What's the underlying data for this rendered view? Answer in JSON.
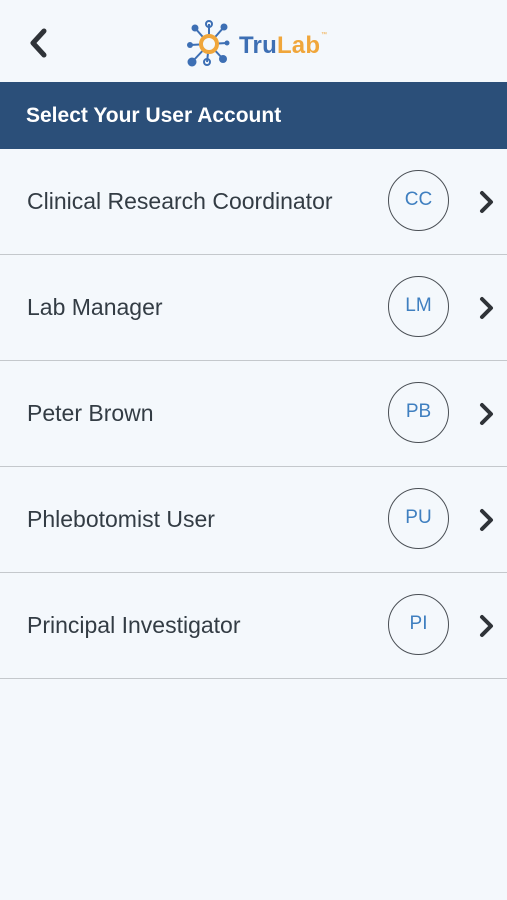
{
  "header": {
    "back_icon": "chevron-left-icon",
    "logo": {
      "tru": "Tru",
      "lab": "Lab",
      "trademark": "™",
      "colors": {
        "tru": "#3d6fb4",
        "lab": "#f0a63b"
      }
    }
  },
  "section": {
    "title": "Select Your User Account",
    "background": "#2b4f79"
  },
  "accounts": [
    {
      "name": "Clinical Research Coordinator",
      "initials": "CC"
    },
    {
      "name": "Lab Manager",
      "initials": "LM"
    },
    {
      "name": "Peter Brown",
      "initials": "PB"
    },
    {
      "name": "Phlebotomist User",
      "initials": "PU"
    },
    {
      "name": "Principal Investigator",
      "initials": "PI"
    }
  ],
  "row_icon": "chevron-right-icon"
}
